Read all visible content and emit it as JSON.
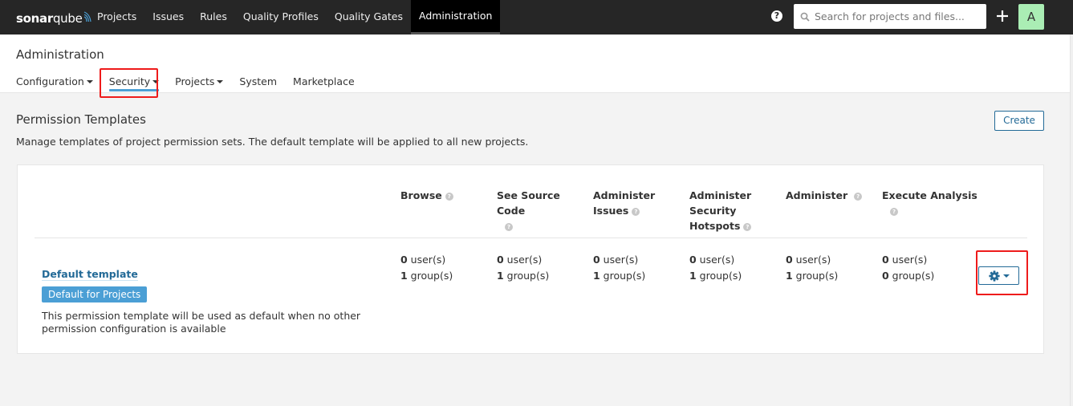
{
  "navbar": {
    "logo_bold": "sonar",
    "logo_light": "qube",
    "items": [
      {
        "label": "Projects",
        "active": false
      },
      {
        "label": "Issues",
        "active": false
      },
      {
        "label": "Rules",
        "active": false
      },
      {
        "label": "Quality Profiles",
        "active": false
      },
      {
        "label": "Quality Gates",
        "active": false
      },
      {
        "label": "Administration",
        "active": true
      }
    ],
    "help_icon": "?",
    "search_placeholder": "Search for projects and files...",
    "avatar_letter": "A",
    "avatar_color": "#aaedb4"
  },
  "admin": {
    "title": "Administration",
    "tabs": [
      {
        "label": "Configuration",
        "dropdown": true,
        "active": false
      },
      {
        "label": "Security",
        "dropdown": true,
        "active": true
      },
      {
        "label": "Projects",
        "dropdown": true,
        "active": false
      },
      {
        "label": "System",
        "dropdown": false,
        "active": false
      },
      {
        "label": "Marketplace",
        "dropdown": false,
        "active": false
      }
    ]
  },
  "page": {
    "title": "Permission Templates",
    "description": "Manage templates of project permission sets. The default template will be applied to all new projects.",
    "create_label": "Create"
  },
  "table": {
    "columns": [
      {
        "label": "Browse"
      },
      {
        "label": "See Source Code"
      },
      {
        "label": "Administer Issues"
      },
      {
        "label": "Administer Security Hotspots"
      },
      {
        "label": "Administer"
      },
      {
        "label": "Execute Analysis"
      }
    ],
    "rows": [
      {
        "name": "Default template",
        "badge": "Default for Projects",
        "description": "This permission template will be used as default when no other permission configuration is available",
        "permissions": [
          {
            "users": "0",
            "groups": "1"
          },
          {
            "users": "0",
            "groups": "1"
          },
          {
            "users": "0",
            "groups": "1"
          },
          {
            "users": "0",
            "groups": "1"
          },
          {
            "users": "0",
            "groups": "1"
          },
          {
            "users": "0",
            "groups": "0"
          }
        ]
      }
    ],
    "users_suffix": " user(s)",
    "groups_suffix": " group(s)"
  },
  "colors": {
    "navbar_bg": "#262626",
    "accent_blue": "#236a97",
    "badge_blue": "#4b9fd5",
    "highlight_red": "#ee1b1b"
  }
}
